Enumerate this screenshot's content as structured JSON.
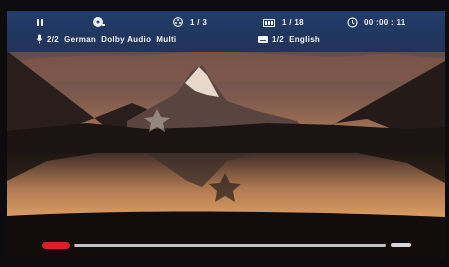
{
  "osd": {
    "pause_icon": "pause-icon",
    "disc_icon": "disc-icon",
    "chapter_icon": "film-reel-icon",
    "chapter": "1 / 3",
    "title_icon": "title-grid-icon",
    "title": "1 / 18",
    "clock_icon": "clock-icon",
    "time": "00 :00 : 11",
    "audio_icon": "microphone-icon",
    "audio": "2/2  German  Dolby Audio  Multi",
    "subtitle_icon": "subtitle-icon",
    "subtitle": "1/2  English"
  },
  "progress": {
    "fraction": 0.004,
    "accent": "#d8202c"
  }
}
